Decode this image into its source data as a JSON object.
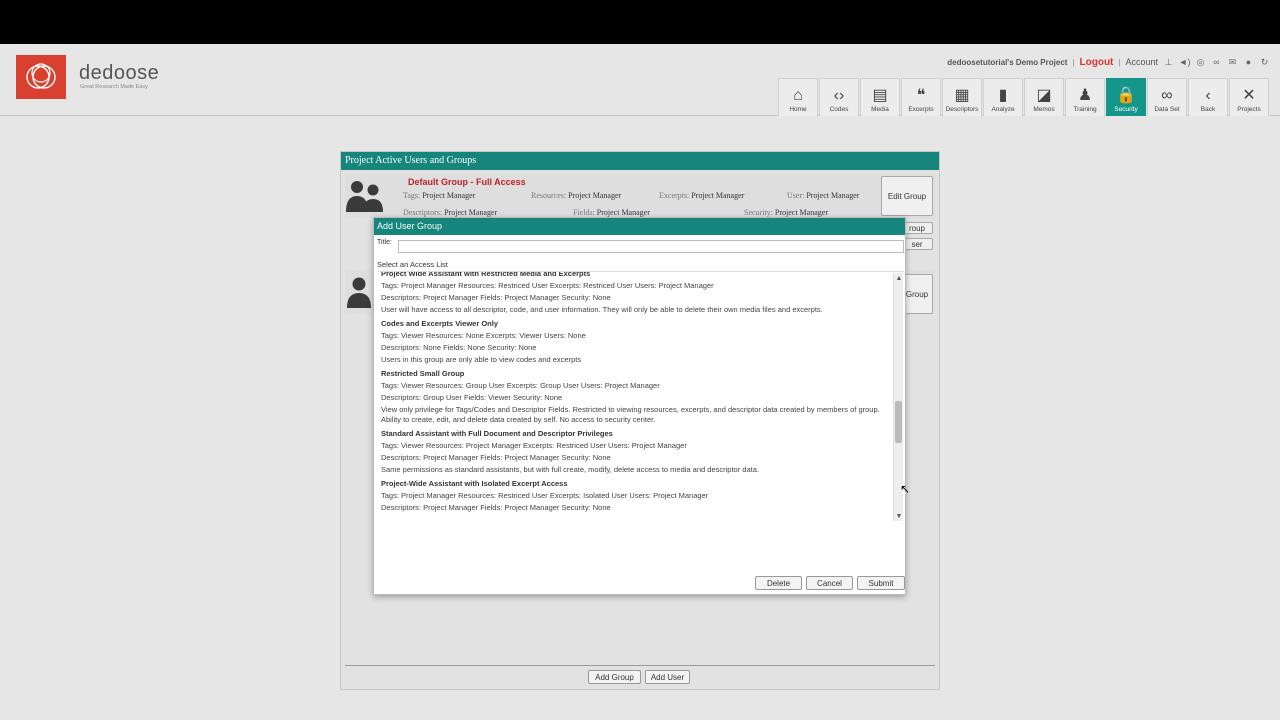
{
  "app": {
    "logo_name": "dedoose",
    "logo_tagline": "Great Research Made Easy",
    "project_label": "dedoosetutorial's Demo Project",
    "logout": "Logout",
    "account": "Account"
  },
  "nav": [
    {
      "label": "Home",
      "icon": "home-icon",
      "glyph": "⌂"
    },
    {
      "label": "Codes",
      "icon": "code-icon",
      "glyph": "‹›"
    },
    {
      "label": "Media",
      "icon": "media-icon",
      "glyph": "▤"
    },
    {
      "label": "Excerpts",
      "icon": "quote-icon",
      "glyph": "❝"
    },
    {
      "label": "Descriptors",
      "icon": "clipboard-icon",
      "glyph": "▦"
    },
    {
      "label": "Analyze",
      "icon": "bar-chart-icon",
      "glyph": "▮"
    },
    {
      "label": "Memos",
      "icon": "memo-icon",
      "glyph": "◪"
    },
    {
      "label": "Training",
      "icon": "trainer-icon",
      "glyph": "♟"
    },
    {
      "label": "Security",
      "icon": "lock-icon",
      "glyph": "🔒",
      "active": true
    },
    {
      "label": "Data Set",
      "icon": "binoculars-icon",
      "glyph": "∞"
    },
    {
      "label": "Back",
      "icon": "back-icon",
      "glyph": "‹"
    },
    {
      "label": "Projects",
      "icon": "projects-icon",
      "glyph": "✕"
    }
  ],
  "panel": {
    "title": "Project Active Users and Groups",
    "group1": {
      "name": "Default Group - Full Access",
      "tags_k": "Tags:",
      "tags_v": "Project Manager",
      "resources_k": "Resources:",
      "resources_v": "Project Manager",
      "excerpts_k": "Excerpts:",
      "excerpts_v": "Project Manager",
      "user_k": "User:",
      "user_v": "Project Manager",
      "descriptors_k": "Descriptors:",
      "descriptors_v": "Project Manager",
      "fields_k": "Fields:",
      "fields_v": "Project Manager",
      "security_k": "Security:",
      "security_v": "Project Manager"
    },
    "edit_group": "Edit Group",
    "peek_group_1": "roup",
    "peek_user": "ser",
    "peek_group_2": "Group",
    "add_group": "Add Group",
    "add_user": "Add User"
  },
  "dialog": {
    "title": "Add User Group",
    "title_label": "Title:",
    "title_value": "",
    "select_label": "Select an Access List",
    "items": [
      {
        "name": "Project Wide Assistant with Restricted Media and Excerpts",
        "line1": "Tags: Project Manager  Resources: Restriced User  Excerpts: Restriced User  Users: Project Manager",
        "line2": "Descriptors: Project Manager  Fields: Project Manager  Security: None",
        "desc": "User will have access to all descriptor, code, and user information. They will only be able to delete their own media files and excerpts."
      },
      {
        "name": "Codes and Excerpts Viewer Only",
        "line1": "Tags: Viewer  Resources: None  Excerpts: Viewer  Users: None",
        "line2": "Descriptors: None  Fields: None  Security: None",
        "desc": "Users in this group are only able to view codes and excerpts"
      },
      {
        "name": "Restricted Small Group",
        "line1": "Tags: Viewer  Resources: Group User  Excerpts: Group User  Users: Project Manager",
        "line2": "Descriptors: Group User  Fields: Viewer  Security: None",
        "desc": "View only privilege for Tags/Codes and Descriptor Fields.  Restricted to viewing resources, excerpts, and descriptor data created by members of group.  Ability to create, edit, and delete data created by self.  No access to security center."
      },
      {
        "name": "Standard Assistant with Full Document and Descriptor Privileges",
        "line1": "Tags: Viewer  Resources: Project Manager  Excerpts: Restriced User  Users: Project Manager",
        "line2": "Descriptors: Project Manager  Fields: Project Manager  Security: None",
        "desc": "Same permissions as standard assistants, but with full create, modify, delete access to media and descriptor data."
      },
      {
        "name": "Project-Wide Assistant with Isolated Excerpt Access",
        "line1": "Tags: Project Manager  Resources: Restriced User  Excerpts: Isolated User  Users: Project Manager",
        "line2": "Descriptors: Project Manager  Fields: Project Manager  Security: None",
        "desc": ""
      }
    ],
    "delete": "Delete",
    "cancel": "Cancel",
    "submit": "Submit"
  },
  "colors": {
    "accent": "#16867d",
    "logo": "#d8412f",
    "logout": "#dd3333",
    "group_title": "#c0212b"
  }
}
